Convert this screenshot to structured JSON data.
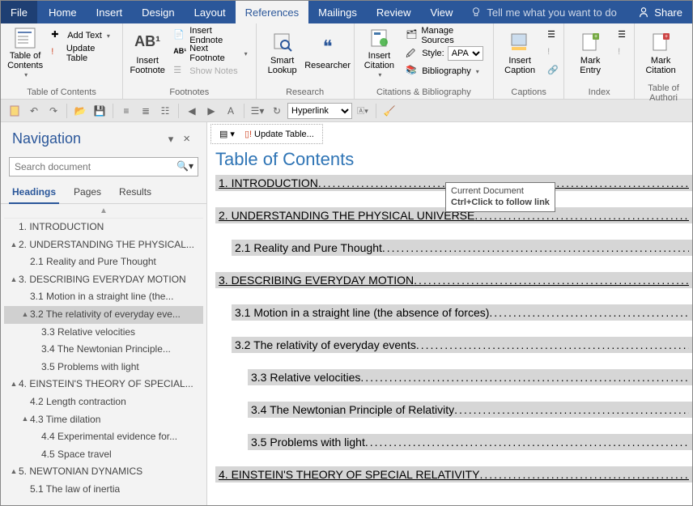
{
  "menubar": {
    "items": [
      "File",
      "Home",
      "Insert",
      "Design",
      "Layout",
      "References",
      "Mailings",
      "Review",
      "View"
    ],
    "active": "References",
    "tellme": "Tell me what you want to do",
    "share": "Share"
  },
  "ribbon": {
    "groups": [
      {
        "label": "Table of Contents",
        "big": {
          "label": "Table of\nContents"
        },
        "small": [
          {
            "label": "Add Text"
          },
          {
            "label": "Update Table"
          }
        ]
      },
      {
        "label": "Footnotes",
        "big": {
          "label": "Insert\nFootnote",
          "badge": "AB¹"
        },
        "small": [
          {
            "label": "Insert Endnote"
          },
          {
            "label": "Next Footnote"
          },
          {
            "label": "Show Notes"
          }
        ]
      },
      {
        "label": "Research",
        "bigs": [
          {
            "label": "Smart\nLookup"
          },
          {
            "label": "Researcher"
          }
        ]
      },
      {
        "label": "Citations & Bibliography",
        "big": {
          "label": "Insert\nCitation"
        },
        "small": [
          {
            "label": "Manage Sources"
          },
          {
            "label": "Style:",
            "select": "APA"
          },
          {
            "label": "Bibliography"
          }
        ]
      },
      {
        "label": "Captions",
        "big": {
          "label": "Insert\nCaption"
        }
      },
      {
        "label": "Index",
        "big": {
          "label": "Mark\nEntry"
        }
      },
      {
        "label": "Table of Authori",
        "big": {
          "label": "Mark\nCitation"
        }
      }
    ]
  },
  "qat": {
    "style_select": "Hyperlink"
  },
  "nav": {
    "title": "Navigation",
    "search_placeholder": "Search document",
    "tabs": [
      "Headings",
      "Pages",
      "Results"
    ],
    "active_tab": "Headings",
    "tree": [
      {
        "depth": 0,
        "caret": "",
        "label": "1.  INTRODUCTION"
      },
      {
        "depth": 0,
        "caret": "▲",
        "label": "2.  UNDERSTANDING THE PHYSICAL..."
      },
      {
        "depth": 1,
        "caret": "",
        "label": "2.1  Reality and Pure Thought"
      },
      {
        "depth": 0,
        "caret": "▲",
        "label": "3.  DESCRIBING EVERYDAY MOTION"
      },
      {
        "depth": 1,
        "caret": "",
        "label": "3.1  Motion in a straight line (the..."
      },
      {
        "depth": 1,
        "caret": "▲",
        "label": "3.2  The relativity of everyday eve...",
        "sel": true
      },
      {
        "depth": 2,
        "caret": "",
        "label": "3.3  Relative velocities"
      },
      {
        "depth": 2,
        "caret": "",
        "label": "3.4  The Newtonian Principle..."
      },
      {
        "depth": 2,
        "caret": "",
        "label": "3.5  Problems with light"
      },
      {
        "depth": 0,
        "caret": "▲",
        "label": "4.  EINSTEIN'S THEORY OF SPECIAL..."
      },
      {
        "depth": 1,
        "caret": "",
        "label": "4.2  Length contraction"
      },
      {
        "depth": 1,
        "caret": "▲",
        "label": "4.3  Time dilation"
      },
      {
        "depth": 2,
        "caret": "",
        "label": "4.4  Experimental evidence for..."
      },
      {
        "depth": 2,
        "caret": "",
        "label": "4.5  Space travel"
      },
      {
        "depth": 0,
        "caret": "▲",
        "label": "5.  NEWTONIAN DYNAMICS"
      },
      {
        "depth": 1,
        "caret": "",
        "label": "5.1  The law of inertia"
      }
    ]
  },
  "toc_toolbar": {
    "update": "Update Table..."
  },
  "toc": {
    "title": "Table of Contents",
    "entries": [
      {
        "level": 1,
        "text": "1.  INTRODUCTION"
      },
      {
        "gap": true
      },
      {
        "level": 1,
        "text": "2.  UNDERSTANDING THE PHYSICAL UNIVERSE"
      },
      {
        "gap": true
      },
      {
        "level": 2,
        "text": "2.1  Reality and Pure Thought"
      },
      {
        "gap": true
      },
      {
        "level": 1,
        "text": "3.  DESCRIBING EVERYDAY MOTION"
      },
      {
        "gap": true
      },
      {
        "level": 2,
        "text": "3.1  Motion in a straight line (the absence of forces)"
      },
      {
        "gap": true
      },
      {
        "level": 2,
        "text": "3.2  The relativity of everyday events"
      },
      {
        "gap": true
      },
      {
        "level": 3,
        "text": "3.3  Relative velocities"
      },
      {
        "gap": true
      },
      {
        "level": 3,
        "text": "3.4  The Newtonian Principle of Relativity"
      },
      {
        "gap": true
      },
      {
        "level": 3,
        "text": "3.5  Problems with light"
      },
      {
        "gap": true
      },
      {
        "level": 1,
        "text": "4.  EINSTEIN'S THEORY OF SPECIAL RELATIVITY"
      }
    ]
  },
  "tooltip": {
    "line1": "Current Document",
    "line2": "Ctrl+Click to follow link"
  }
}
